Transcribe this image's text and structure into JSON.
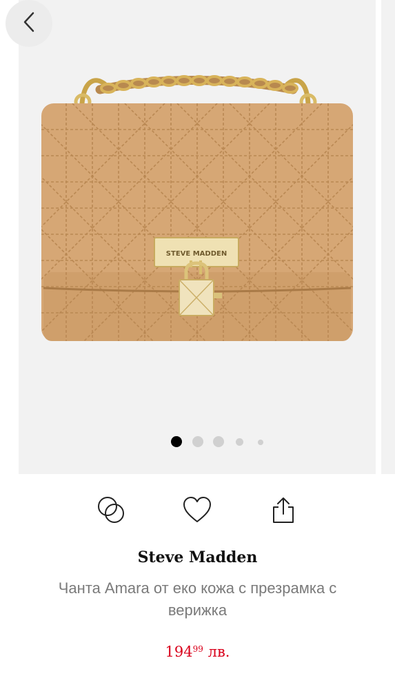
{
  "nav": {
    "back_icon": "chevron-left-icon"
  },
  "gallery": {
    "image_subject": "bag-image",
    "bag_color": "#d7a877",
    "slide_count": 5,
    "active_slide": 1,
    "logo_text": "STEVE MADDEN"
  },
  "actions": {
    "compare_icon": "compare-circles-icon",
    "favorite_icon": "heart-icon",
    "share_icon": "share-icon"
  },
  "product": {
    "brand": "Steve Madden",
    "name": "Чанта Amara от еко кожа с презрамка с верижка",
    "price_main": "194",
    "price_cents": "99",
    "currency": "лв.",
    "price_color": "#d9001b"
  }
}
